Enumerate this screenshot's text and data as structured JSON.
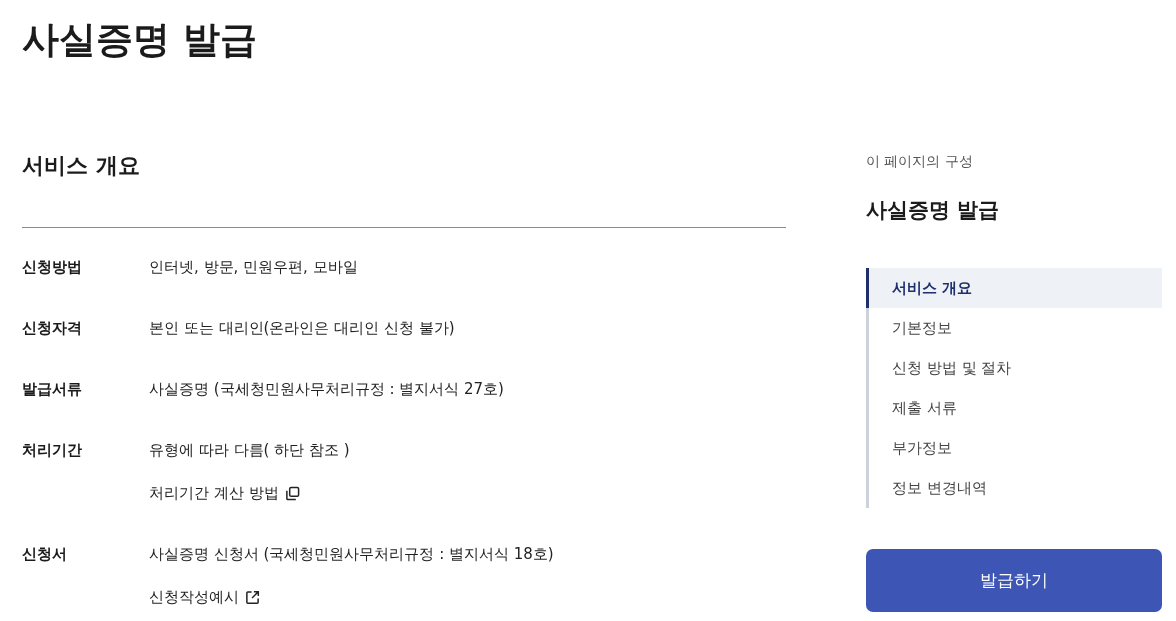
{
  "page": {
    "title": "사실증명 발급"
  },
  "overview": {
    "heading": "서비스 개요",
    "rows": [
      {
        "label": "신청방법",
        "values": [
          {
            "kind": "text",
            "text": "인터넷, 방문, 민원우편, 모바일"
          }
        ]
      },
      {
        "label": "신청자격",
        "values": [
          {
            "kind": "text",
            "text": "본인 또는 대리인(온라인은 대리인 신청 불가)"
          }
        ]
      },
      {
        "label": "발급서류",
        "values": [
          {
            "kind": "text",
            "text": "사실증명 (국세청민원사무처리규정 : 별지서식 27호)"
          }
        ]
      },
      {
        "label": "처리기간",
        "values": [
          {
            "kind": "text",
            "text": "유형에 따라 다름( 하단 참조 )"
          },
          {
            "kind": "popup",
            "text": "처리기간 계산 방법"
          }
        ]
      },
      {
        "label": "신청서",
        "values": [
          {
            "kind": "text",
            "text": "사실증명 신청서 (국세청민원사무처리규정 : 별지서식 18호)"
          },
          {
            "kind": "external",
            "text": "신청작성예시"
          }
        ]
      }
    ]
  },
  "toc": {
    "caption": "이 페이지의 구성",
    "title": "사실증명 발급",
    "items": [
      {
        "label": "서비스 개요",
        "selected": true
      },
      {
        "label": "기본정보",
        "selected": false
      },
      {
        "label": "신청 방법 및 절차",
        "selected": false
      },
      {
        "label": "제출 서류",
        "selected": false
      },
      {
        "label": "부가정보",
        "selected": false
      },
      {
        "label": "정보 변경내역",
        "selected": false
      }
    ]
  },
  "action": {
    "label": "발급하기"
  }
}
